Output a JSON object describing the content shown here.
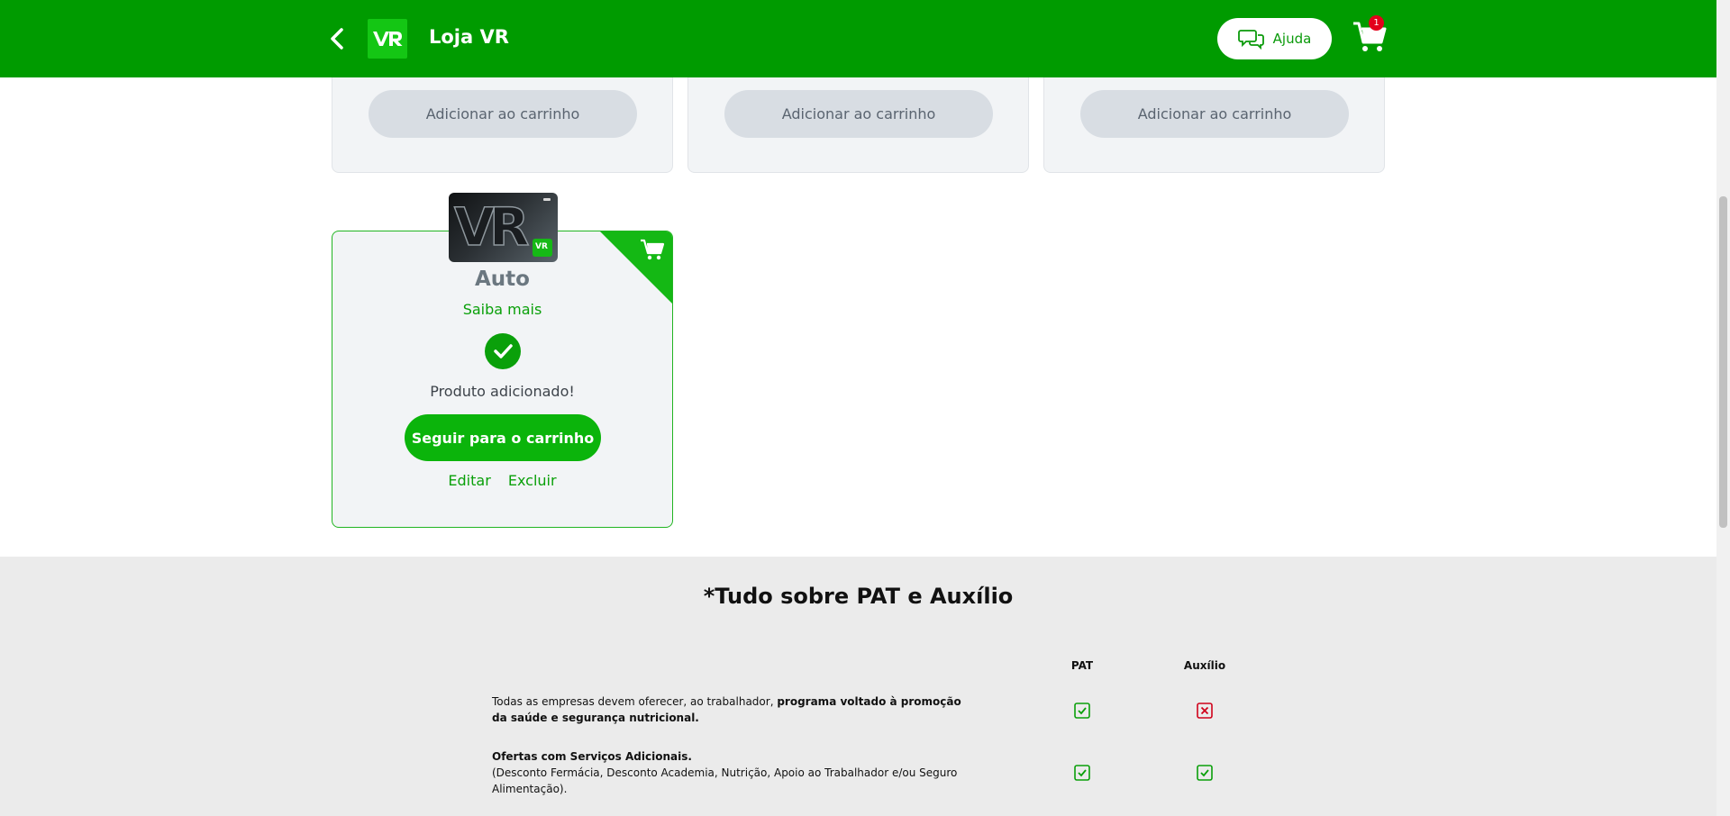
{
  "header": {
    "title": "Loja VR",
    "help_label": "Ajuda",
    "cart_count": "1"
  },
  "top_cards": [
    {
      "add_label": "Adicionar ao carrinho"
    },
    {
      "add_label": "Adicionar ao carrinho"
    },
    {
      "add_label": "Adicionar ao carrinho"
    }
  ],
  "auto_card": {
    "logo_text": "VR",
    "title": "Auto",
    "more_link": "Saiba mais",
    "added_text": "Produto adicionado!",
    "go_cart_label": "Seguir para o carrinho",
    "edit_label": "Editar",
    "delete_label": "Excluir"
  },
  "pat": {
    "title": "*Tudo sobre PAT e Auxílio",
    "columns": [
      "PAT",
      "Auxílio"
    ],
    "rows": [
      {
        "text_normal": "Todas as empresas devem oferecer, ao trabalhador, ",
        "text_bold": "programa voltado à promoção da saúde e segurança nutricional.",
        "pat": "check",
        "auxilio": "cross"
      },
      {
        "text_bold": "Ofertas com Serviços Adicionais.",
        "text_normal": "(Desconto Fermácia, Desconto Academia, Nutrição, Apoio ao Trabalhador e/ou Seguro Alimentação).",
        "pat": "check",
        "auxilio": "check"
      }
    ]
  },
  "colors": {
    "brand_green": "#009b00",
    "button_green": "#0bb40b",
    "badge_red": "#e3001b",
    "cross_red": "#d0021b"
  }
}
